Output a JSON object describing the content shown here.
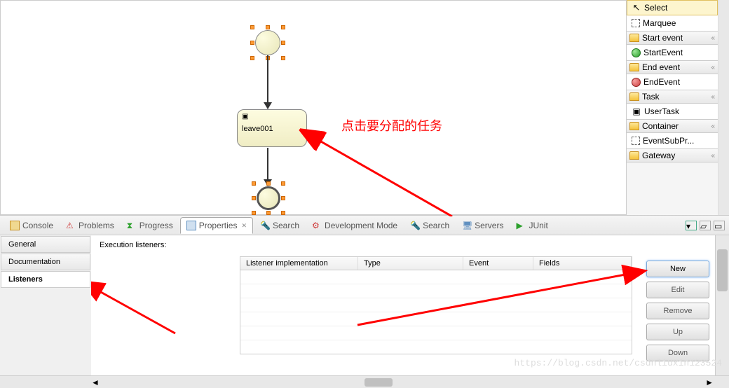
{
  "canvas": {
    "task_label": "leave001"
  },
  "annotation": {
    "text": "点击要分配的任务"
  },
  "palette": {
    "select": "Select",
    "marquee": "Marquee",
    "groups": {
      "start_event": "Start event",
      "end_event": "End event",
      "task": "Task",
      "container": "Container",
      "gateway": "Gateway"
    },
    "items": {
      "start_event": "StartEvent",
      "end_event": "EndEvent",
      "user_task": "UserTask",
      "event_subprocess": "EventSubPr..."
    }
  },
  "tabs": {
    "console": "Console",
    "problems": "Problems",
    "progress": "Progress",
    "properties": "Properties",
    "search1": "Search",
    "dev_mode": "Development Mode",
    "search2": "Search",
    "servers": "Servers",
    "junit": "JUnit",
    "close_x": "✕"
  },
  "properties": {
    "tabs": {
      "general": "General",
      "documentation": "Documentation",
      "listeners": "Listeners"
    },
    "header": "Execution listeners:",
    "table": {
      "col1": "Listener implementation",
      "col2": "Type",
      "col3": "Event",
      "col4": "Fields"
    },
    "buttons": {
      "new": "New",
      "edit": "Edit",
      "remove": "Remove",
      "up": "Up",
      "down": "Down"
    }
  },
  "watermark": "https://blog.csdn.net/csdnliuxin123524"
}
